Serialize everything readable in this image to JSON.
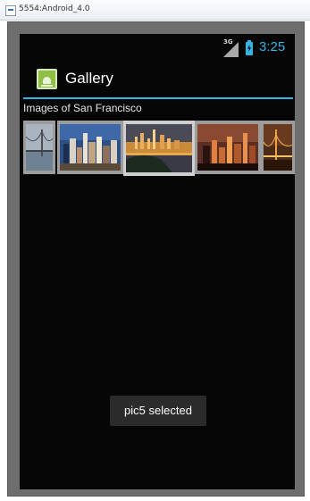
{
  "window": {
    "title": "5554:Android_4.0"
  },
  "status_bar": {
    "network": "3G",
    "time": "3:25"
  },
  "action_bar": {
    "title": "Gallery"
  },
  "label": "Images of San Francisco",
  "gallery": {
    "items": [
      {
        "name": "pic-bridge-fog"
      },
      {
        "name": "pic-city-skyline-blue"
      },
      {
        "name": "pic-city-night-golden"
      },
      {
        "name": "pic-city-night-red"
      },
      {
        "name": "pic-golden-gate-night"
      }
    ],
    "selected_index": 2
  },
  "toast": {
    "text": "pic5 selected"
  },
  "colors": {
    "accent": "#33b5e5",
    "screen": "#060606",
    "toast": "#2b2b2b"
  }
}
